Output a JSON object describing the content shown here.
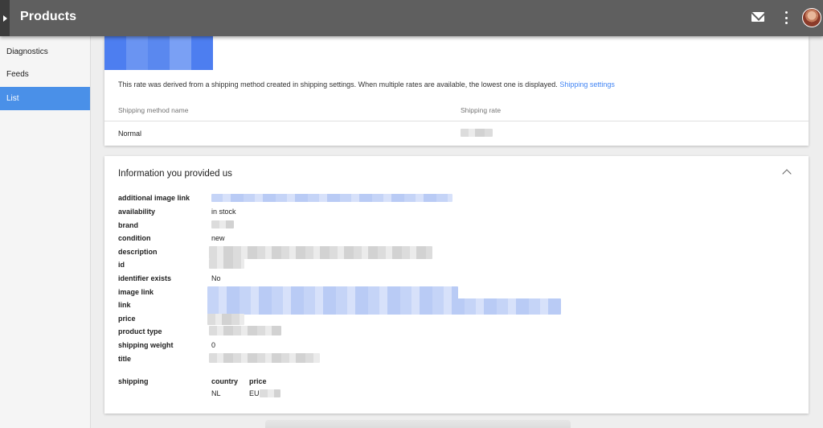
{
  "appbar": {
    "title": "Products",
    "icons": [
      "mail-icon",
      "more-vert-icon",
      "avatar"
    ]
  },
  "sidebar": {
    "items": [
      {
        "label": "Diagnostics",
        "active": false
      },
      {
        "label": "Feeds",
        "active": false
      },
      {
        "label": "List",
        "active": true
      }
    ]
  },
  "shipping_card": {
    "note": "This rate was derived from a shipping method created in shipping settings. When multiple rates are available, the lowest one is displayed.",
    "settings_link": "Shipping settings",
    "columns": [
      "Shipping method name",
      "Shipping rate"
    ],
    "rows": [
      {
        "method": "Normal",
        "rate": ""
      }
    ]
  },
  "info_card": {
    "title": "Information you provided us",
    "attributes": [
      {
        "label": "additional image link",
        "value": ""
      },
      {
        "label": "availability",
        "value": "in stock"
      },
      {
        "label": "brand",
        "value": ""
      },
      {
        "label": "condition",
        "value": "new"
      },
      {
        "label": "description",
        "value": ""
      },
      {
        "label": "id",
        "value": ""
      },
      {
        "label": "identifier exists",
        "value": "No"
      },
      {
        "label": "image link",
        "value": ""
      },
      {
        "label": "link",
        "value": ""
      },
      {
        "label": "price",
        "value": ""
      },
      {
        "label": "product type",
        "value": ""
      },
      {
        "label": "shipping weight",
        "value": "0"
      },
      {
        "label": "title",
        "value": ""
      }
    ],
    "shipping": {
      "label": "shipping",
      "columns": [
        "country",
        "price"
      ],
      "country": "NL",
      "price": "EU"
    }
  },
  "colors": {
    "appbar": "#5f5f5f",
    "active_nav": "#4a90e8",
    "link": "#4285f4"
  }
}
